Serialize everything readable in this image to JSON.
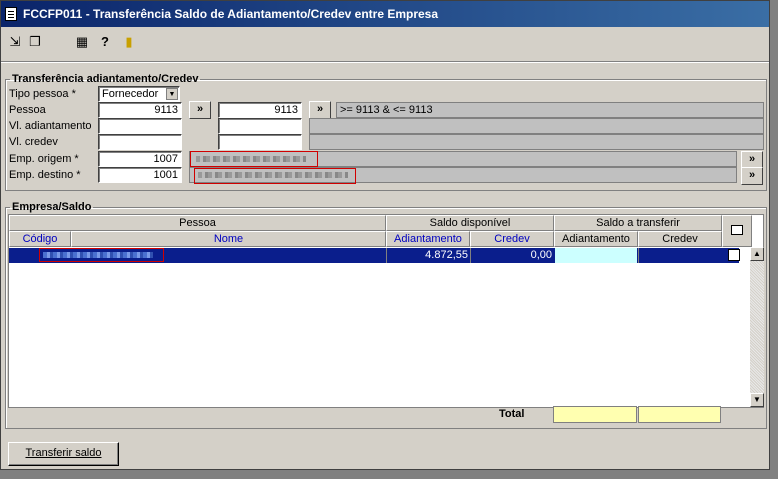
{
  "window": {
    "title": "FCCFP011 - Transferência Saldo de Adiantamento/Credev entre Empresa"
  },
  "toolbar": {
    "icons": [
      "export-icon",
      "copy-icon",
      "calendar-icon",
      "help-icon",
      "exit-icon"
    ]
  },
  "section1": {
    "legend": "Transferência adiantamento/Credev",
    "tipo_pessoa_label": "Tipo pessoa *",
    "tipo_pessoa_value": "Fornecedor",
    "pessoa_label": "Pessoa",
    "pessoa_from": "9113",
    "pessoa_to": "9113",
    "pessoa_range_text": ">= 9113 & <= 9113",
    "vl_adiantamento_label": "Vl. adiantamento",
    "vl_credev_label": "Vl. credev",
    "emp_origem_label": "Emp. origem *",
    "emp_origem_value": "1007",
    "emp_destino_label": "Emp. destino *",
    "emp_destino_value": "1001",
    "lookup_label": "»"
  },
  "section2": {
    "legend": "Empresa/Saldo",
    "group_pessoa": "Pessoa",
    "group_saldo_disponivel": "Saldo disponível",
    "group_saldo_transferir": "Saldo a transferir",
    "col_codigo": "Código",
    "col_nome": "Nome",
    "col_adiantamento": "Adiantamento",
    "col_credev": "Credev",
    "col_t_adiantamento": "Adiantamento",
    "col_t_credev": "Credev",
    "row": {
      "adiantamento": "4.872,55",
      "credev": "0,00"
    },
    "total_label": "Total"
  },
  "footer": {
    "transfer_button": "Transferir saldo"
  }
}
